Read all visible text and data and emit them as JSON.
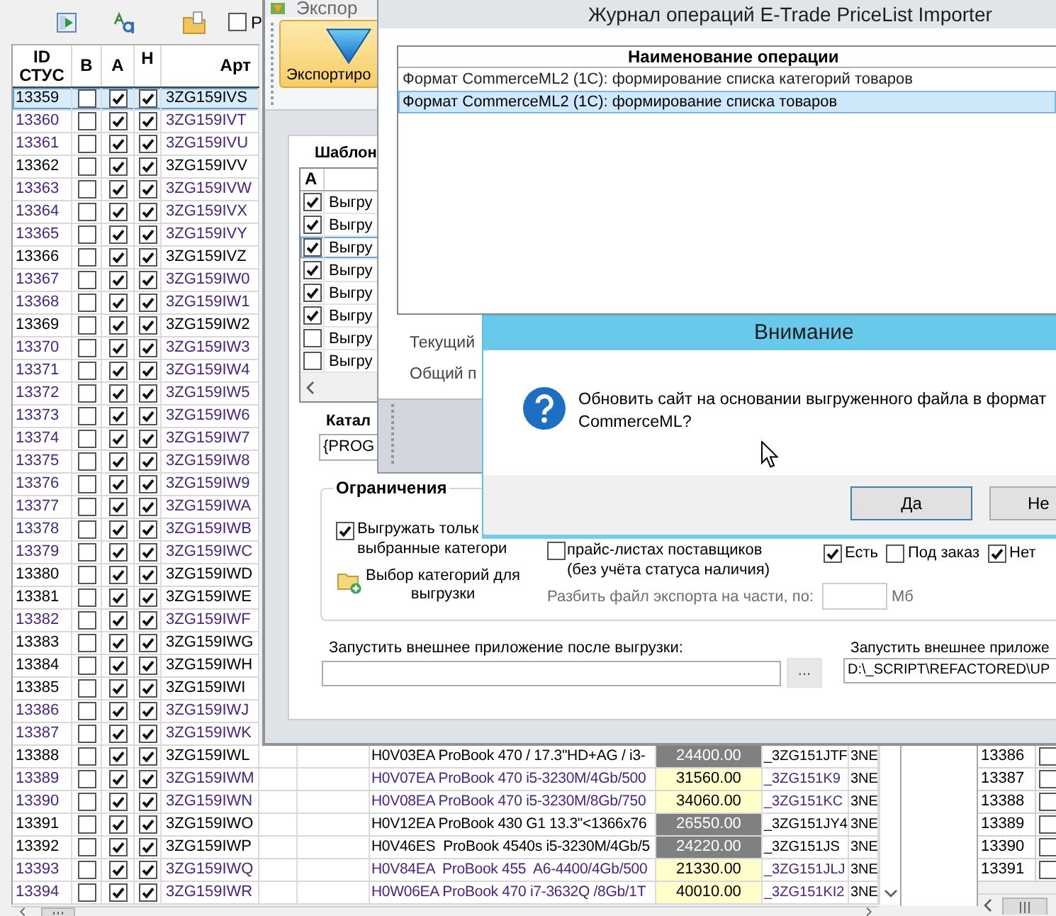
{
  "toolbar": {
    "checkbox": {
      "label": "P",
      "checked": false
    }
  },
  "grid": {
    "columns": [
      "ID СТУС",
      "В",
      "А",
      "Н",
      "Арт"
    ],
    "rows": [
      {
        "id": "13359",
        "checks": [
          false,
          true,
          true
        ],
        "art": "3ZG159IVS",
        "color": "#000000",
        "selected": true
      },
      {
        "id": "13360",
        "checks": [
          false,
          true,
          true
        ],
        "art": "3ZG159IVT",
        "color": "#4b2482",
        "selected": false
      },
      {
        "id": "13361",
        "checks": [
          false,
          true,
          true
        ],
        "art": "3ZG159IVU",
        "color": "#4b2482",
        "selected": false
      },
      {
        "id": "13362",
        "checks": [
          false,
          true,
          true
        ],
        "art": "3ZG159IVV",
        "color": "#000000",
        "selected": false
      },
      {
        "id": "13363",
        "checks": [
          false,
          true,
          true
        ],
        "art": "3ZG159IVW",
        "color": "#4b2482",
        "selected": false
      },
      {
        "id": "13364",
        "checks": [
          false,
          true,
          true
        ],
        "art": "3ZG159IVX",
        "color": "#4b2482",
        "selected": false
      },
      {
        "id": "13365",
        "checks": [
          false,
          true,
          true
        ],
        "art": "3ZG159IVY",
        "color": "#4b2482",
        "selected": false
      },
      {
        "id": "13366",
        "checks": [
          false,
          true,
          true
        ],
        "art": "3ZG159IVZ",
        "color": "#000000",
        "selected": false
      },
      {
        "id": "13367",
        "checks": [
          false,
          true,
          true
        ],
        "art": "3ZG159IW0",
        "color": "#4b2482",
        "selected": false
      },
      {
        "id": "13368",
        "checks": [
          false,
          true,
          true
        ],
        "art": "3ZG159IW1",
        "color": "#4b2482",
        "selected": false
      },
      {
        "id": "13369",
        "checks": [
          false,
          true,
          true
        ],
        "art": "3ZG159IW2",
        "color": "#000000",
        "selected": false
      },
      {
        "id": "13370",
        "checks": [
          false,
          true,
          true
        ],
        "art": "3ZG159IW3",
        "color": "#4b2482",
        "selected": false
      },
      {
        "id": "13371",
        "checks": [
          false,
          true,
          true
        ],
        "art": "3ZG159IW4",
        "color": "#4b2482",
        "selected": false
      },
      {
        "id": "13372",
        "checks": [
          false,
          true,
          true
        ],
        "art": "3ZG159IW5",
        "color": "#4b2482",
        "selected": false
      },
      {
        "id": "13373",
        "checks": [
          false,
          true,
          true
        ],
        "art": "3ZG159IW6",
        "color": "#4b2482",
        "selected": false
      },
      {
        "id": "13374",
        "checks": [
          false,
          true,
          true
        ],
        "art": "3ZG159IW7",
        "color": "#4b2482",
        "selected": false
      },
      {
        "id": "13375",
        "checks": [
          false,
          true,
          true
        ],
        "art": "3ZG159IW8",
        "color": "#4b2482",
        "selected": false
      },
      {
        "id": "13376",
        "checks": [
          false,
          true,
          true
        ],
        "art": "3ZG159IW9",
        "color": "#4b2482",
        "selected": false
      },
      {
        "id": "13377",
        "checks": [
          false,
          true,
          true
        ],
        "art": "3ZG159IWA",
        "color": "#4b2482",
        "selected": false
      },
      {
        "id": "13378",
        "checks": [
          false,
          true,
          true
        ],
        "art": "3ZG159IWB",
        "color": "#4b2482",
        "selected": false
      },
      {
        "id": "13379",
        "checks": [
          false,
          true,
          true
        ],
        "art": "3ZG159IWC",
        "color": "#4b2482",
        "selected": false
      },
      {
        "id": "13380",
        "checks": [
          false,
          true,
          true
        ],
        "art": "3ZG159IWD",
        "color": "#000000",
        "selected": false
      },
      {
        "id": "13381",
        "checks": [
          false,
          true,
          true
        ],
        "art": "3ZG159IWE",
        "color": "#000000",
        "selected": false
      },
      {
        "id": "13382",
        "checks": [
          false,
          true,
          true
        ],
        "art": "3ZG159IWF",
        "color": "#4b2482",
        "selected": false
      },
      {
        "id": "13383",
        "checks": [
          false,
          true,
          true
        ],
        "art": "3ZG159IWG",
        "color": "#000000",
        "selected": false
      },
      {
        "id": "13384",
        "checks": [
          false,
          true,
          true
        ],
        "art": "3ZG159IWH",
        "color": "#000000",
        "selected": false
      },
      {
        "id": "13385",
        "checks": [
          false,
          true,
          true
        ],
        "art": "3ZG159IWI",
        "color": "#000000",
        "selected": false
      },
      {
        "id": "13386",
        "checks": [
          false,
          true,
          true
        ],
        "art": "3ZG159IWJ",
        "color": "#4b2482",
        "selected": false
      },
      {
        "id": "13387",
        "checks": [
          false,
          true,
          true
        ],
        "art": "3ZG159IWK",
        "color": "#4b2482",
        "selected": false
      },
      {
        "id": "13388",
        "checks": [
          false,
          true,
          true
        ],
        "art": "3ZG159IWL",
        "color": "#000000",
        "selected": false,
        "column_8": "H0V03EA ProBook 470 / 17.3\"HD+AG / i3-",
        "column_9": {
          "text": "24400.00",
          "color": "#808080"
        },
        "column_10": "_3ZG151JTF",
        "column_11": "3NE"
      },
      {
        "id": "13389",
        "checks": [
          false,
          true,
          true
        ],
        "art": "3ZG159IWM",
        "color": "#4b2482",
        "selected": false,
        "column_8": "H0V07EA ProBook 470 i5-3230M/4Gb/500",
        "column_9": {
          "text": "31560.00",
          "color": "#ffffcc"
        },
        "column_10": "_3ZG151K9",
        "column_11": "3NE"
      },
      {
        "id": "13390",
        "checks": [
          false,
          true,
          true
        ],
        "art": "3ZG159IWN",
        "color": "#4b2482",
        "selected": false,
        "column_8": "H0V08EA ProBook 470 i5-3230M/8Gb/750",
        "column_9": {
          "text": "34060.00",
          "color": "#ffffcc"
        },
        "column_10": "_3ZG151KC",
        "column_11": "3NE"
      },
      {
        "id": "13391",
        "checks": [
          false,
          true,
          true
        ],
        "art": "3ZG159IWO",
        "color": "#000000",
        "selected": false,
        "column_8": "H0V12EA ProBook 430 G1 13.3\"<1366x76",
        "column_9": {
          "text": "26550.00",
          "color": "#808080"
        },
        "column_10": "_3ZG151JY4",
        "column_11": "3NE"
      },
      {
        "id": "13392",
        "checks": [
          false,
          true,
          true
        ],
        "art": "3ZG159IWP",
        "color": "#000000",
        "selected": false,
        "column_8": "H0V46ES  ProBook 4540s i5-3230M/4Gb/5",
        "column_9": {
          "text": "24220.00",
          "color": "#808080"
        },
        "column_10": "_3ZG151JS",
        "column_11": "3NE"
      },
      {
        "id": "13393",
        "checks": [
          false,
          true,
          true
        ],
        "art": "3ZG159IWQ",
        "color": "#4b2482",
        "selected": false,
        "column_8": "H0V84EA  ProBook 455  A6-4400/4Gb/500",
        "column_9": {
          "text": "21330.00",
          "color": "#ffffcc"
        },
        "column_10": "_3ZG151JLJ",
        "column_11": "3NE"
      },
      {
        "id": "13394",
        "checks": [
          false,
          true,
          true
        ],
        "art": "3ZG159IWR",
        "color": "#4b2482",
        "selected": false,
        "column_8": "H0W06EA ProBook 470 i7-3632Q /8Gb/1T",
        "column_9": {
          "text": "40010.00",
          "color": "#ffffcc"
        },
        "column_10": "_3ZG151KI2",
        "column_11": "3NE"
      }
    ]
  },
  "side_grid": {
    "rows": [
      {
        "id": "13386",
        "checked": false
      },
      {
        "id": "13387",
        "checked": false
      },
      {
        "id": "13388",
        "checked": false
      },
      {
        "id": "13389",
        "checked": false
      },
      {
        "id": "13390",
        "checked": false
      },
      {
        "id": "13391",
        "checked": false
      }
    ]
  },
  "export_window": {
    "title": "Экспор",
    "ribbon_button": "Экспортиро",
    "templates": {
      "label": "Шаблон",
      "header": "А",
      "rows": [
        {
          "text": "Выгру",
          "checked": true,
          "selected": false
        },
        {
          "text": "Выгру",
          "checked": true,
          "selected": false
        },
        {
          "text": "Выгру",
          "checked": true,
          "selected": true
        },
        {
          "text": "Выгру",
          "checked": true,
          "selected": false
        },
        {
          "text": "Выгру",
          "checked": true,
          "selected": false
        },
        {
          "text": "Выгру",
          "checked": true,
          "selected": false
        },
        {
          "text": "Выгру",
          "checked": false,
          "selected": false
        },
        {
          "text": "Выгру",
          "checked": false,
          "selected": false
        }
      ]
    },
    "catalog": {
      "label": "Катал",
      "value": "{PROG"
    },
    "restrictions": {
      "title": "Ограничения",
      "only_selected": {
        "lines": [
          "Выгружать тольк",
          "выбранные категори"
        ],
        "checked": true
      },
      "choose_categories": {
        "lines": [
          "Выбор категорий для",
          "выгрузки"
        ]
      },
      "supplier_lists": {
        "lines": [
          "прайс-листах поставщиков",
          "(без учёта статуса наличия)"
        ],
        "checked": false
      },
      "availability": [
        {
          "label": "Есть",
          "checked": true
        },
        {
          "label": "Под заказ",
          "checked": false
        },
        {
          "label": "Нет",
          "checked": true
        }
      ],
      "split": {
        "label": "Разбить файл экспорта на части, по:",
        "unit": "Мб",
        "disabled": true
      }
    },
    "run_after": {
      "label": "Запустить внешнее приложение после выгрузки:",
      "browse": "..."
    },
    "run_other": {
      "label": "Запустить внешнее приложе",
      "value": "D:\\_SCRIPT\\REFACTORED\\UP"
    }
  },
  "journal_window": {
    "title": "Журнал операций E-Trade PriceList Importer",
    "column": "Наименование операции",
    "rows": [
      {
        "text": "Формат CommerceML2 (1C): формирование списка категорий товаров",
        "selected": false
      },
      {
        "text": "Формат CommerceML2 (1C): формирование списка товаров",
        "selected": true
      }
    ],
    "current_label": "Текущий",
    "total_label": "Общий п"
  },
  "dialog": {
    "title": "Внимание",
    "message_lines": [
      "Обновить сайт на основании выгруженного файла в формат",
      "CommerceML?"
    ],
    "buttons": [
      {
        "label": "Да",
        "default": true
      },
      {
        "label": "Не",
        "default": false
      }
    ]
  }
}
